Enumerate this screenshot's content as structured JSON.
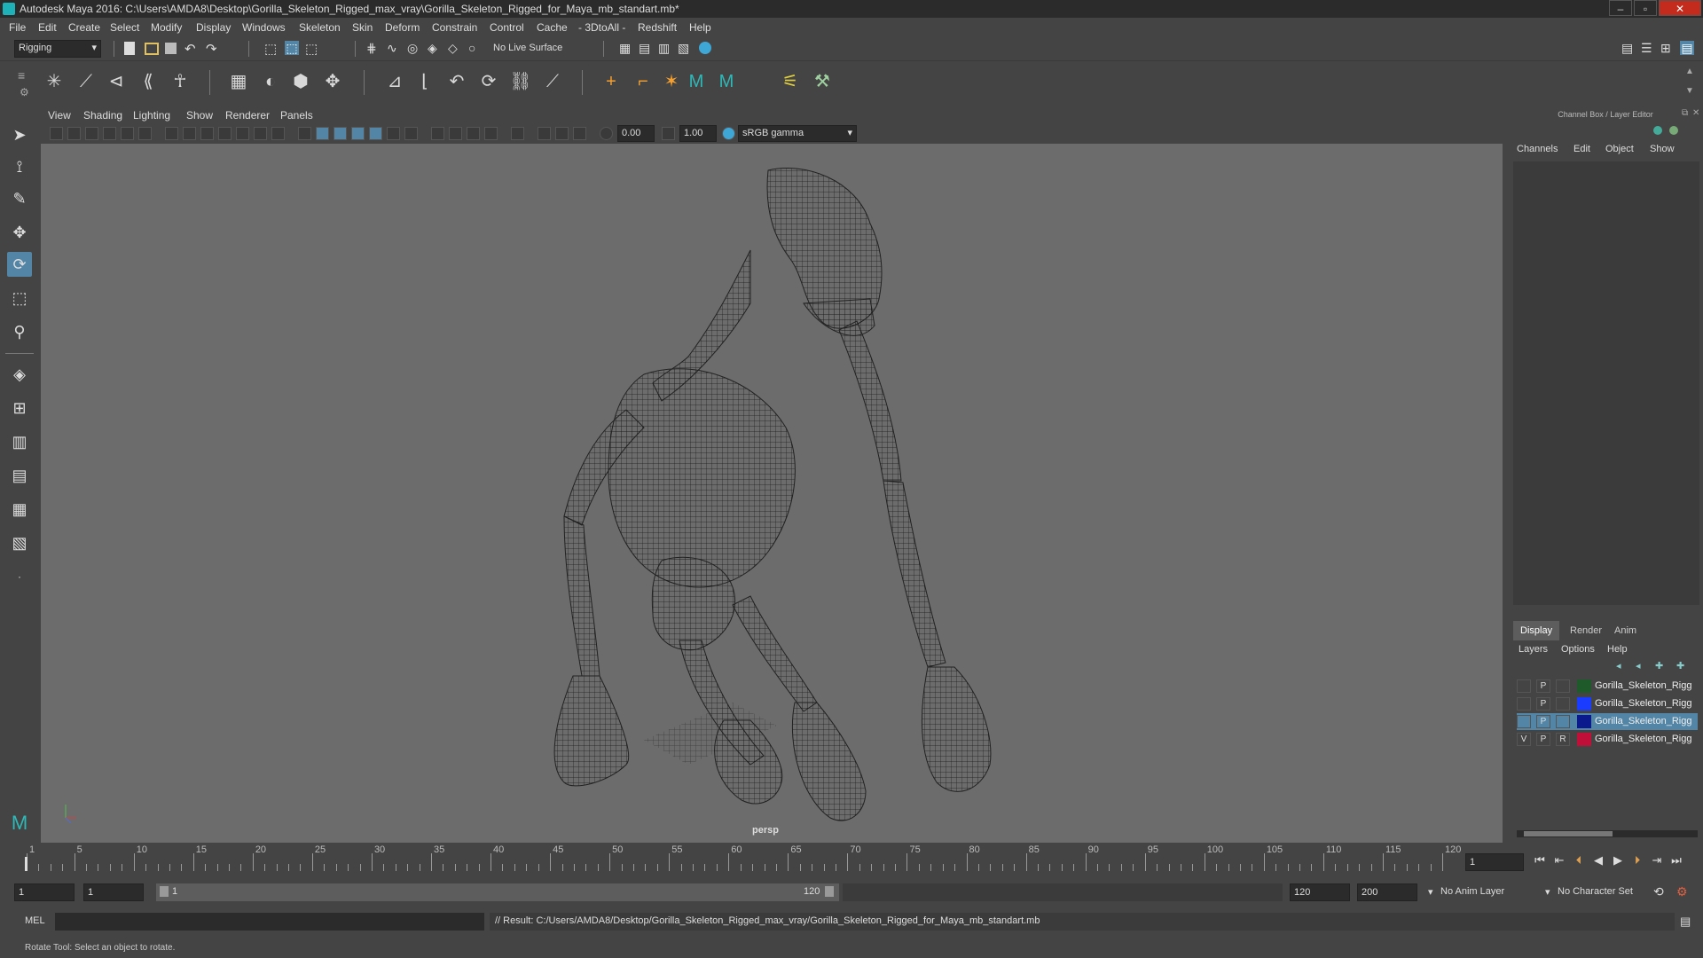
{
  "window": {
    "title": "Autodesk Maya 2016: C:\\Users\\AMDA8\\Desktop\\Gorilla_Skeleton_Rigged_max_vray\\Gorilla_Skeleton_Rigged_for_Maya_mb_standart.mb*",
    "minimize": "–",
    "maximize": "▫",
    "close": "✕"
  },
  "menubar": [
    "File",
    "Edit",
    "Create",
    "Select",
    "Modify",
    "Display",
    "Windows",
    "Skeleton",
    "Skin",
    "Deform",
    "Constrain",
    "Control",
    "Cache",
    "- 3DtoAll -",
    "Redshift",
    "Help"
  ],
  "status_line": {
    "menu_set": "Rigging",
    "live_surface": "No Live Surface"
  },
  "viewport": {
    "menu": [
      "View",
      "Shading",
      "Lighting",
      "Show",
      "Renderer",
      "Panels"
    ],
    "exposure": "0.00",
    "gamma": "1.00",
    "color_space": "sRGB gamma",
    "camera_label": "persp"
  },
  "channel_box": {
    "header": "Channel Box / Layer Editor",
    "menu": [
      "Channels",
      "Edit",
      "Object",
      "Show"
    ],
    "layer_tabs": [
      "Display",
      "Render",
      "Anim"
    ],
    "layer_menu": [
      "Layers",
      "Options",
      "Help"
    ],
    "layers": [
      {
        "v": "",
        "p": "P",
        "r": "",
        "color": "#1f5a2a",
        "name": "Gorilla_Skeleton_Rigg",
        "selected": false
      },
      {
        "v": "",
        "p": "P",
        "r": "",
        "color": "#1a3cff",
        "name": "Gorilla_Skeleton_Rigg",
        "selected": false
      },
      {
        "v": "",
        "p": "P",
        "r": "",
        "color": "#0b1a8c",
        "name": "Gorilla_Skeleton_Rigg",
        "selected": true
      },
      {
        "v": "V",
        "p": "P",
        "r": "R",
        "color": "#c0103a",
        "name": "Gorilla_Skeleton_Rigg",
        "selected": false
      }
    ]
  },
  "time_slider": {
    "ticks": [
      "1",
      "5",
      "10",
      "15",
      "20",
      "25",
      "30",
      "35",
      "40",
      "45",
      "50",
      "55",
      "60",
      "65",
      "70",
      "75",
      "80",
      "85",
      "90",
      "95",
      "100",
      "105",
      "110",
      "115",
      "120"
    ],
    "current_frame": "1"
  },
  "range": {
    "start": "1",
    "anim_start": "1",
    "slider_start": "1",
    "slider_end": "120",
    "anim_end": "120",
    "end": "200",
    "anim_layer": "No Anim Layer",
    "character_set": "No Character Set"
  },
  "command_line": {
    "lang": "MEL",
    "result": "// Result: C:/Users/AMDA8/Desktop/Gorilla_Skeleton_Rigged_max_vray/Gorilla_Skeleton_Rigged_for_Maya_mb_standart.mb"
  },
  "help_line": "Rotate Tool: Select an object to rotate."
}
